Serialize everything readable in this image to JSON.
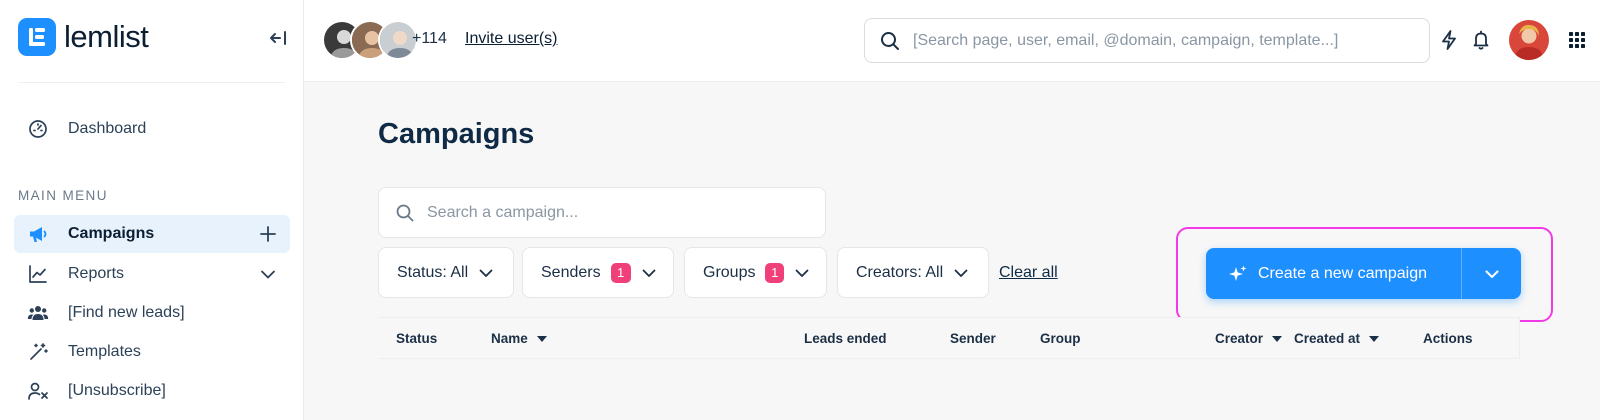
{
  "brand": {
    "name": "lemlist"
  },
  "sidebar": {
    "dashboard_label": "Dashboard",
    "section_label": "MAIN MENU",
    "items": [
      {
        "label": "Campaigns",
        "icon": "megaphone-icon",
        "active": true
      },
      {
        "label": "Reports",
        "icon": "chart-line-icon"
      },
      {
        "label": "[Find new leads]",
        "icon": "users-icon"
      },
      {
        "label": "Templates",
        "icon": "magic-wand-icon"
      },
      {
        "label": "[Unsubscribe]",
        "icon": "user-remove-icon"
      }
    ]
  },
  "header": {
    "avatar_count": "+114",
    "invite_label": "Invite user(s)",
    "search_placeholder": "[Search page, user, email, @domain, campaign, template...]",
    "icons": [
      "lightning-icon",
      "bell-icon",
      "apps-grid-icon"
    ]
  },
  "main": {
    "title": "Campaigns",
    "search_placeholder": "Search a campaign...",
    "filters": [
      {
        "label": "Status: All"
      },
      {
        "label": "Senders",
        "badge": "1"
      },
      {
        "label": "Groups",
        "badge": "1"
      },
      {
        "label": "Creators: All"
      }
    ],
    "clear_all": "Clear all",
    "create_button": "Create a new campaign",
    "table_headers": [
      "Status",
      "Name",
      "Leads ended",
      "Sender",
      "Group",
      "Creator",
      "Created at",
      "Actions"
    ]
  },
  "colors": {
    "accent": "#1e8fff",
    "badge": "#f0407a",
    "highlight": "#f23ae6",
    "title": "#0f2a44"
  }
}
